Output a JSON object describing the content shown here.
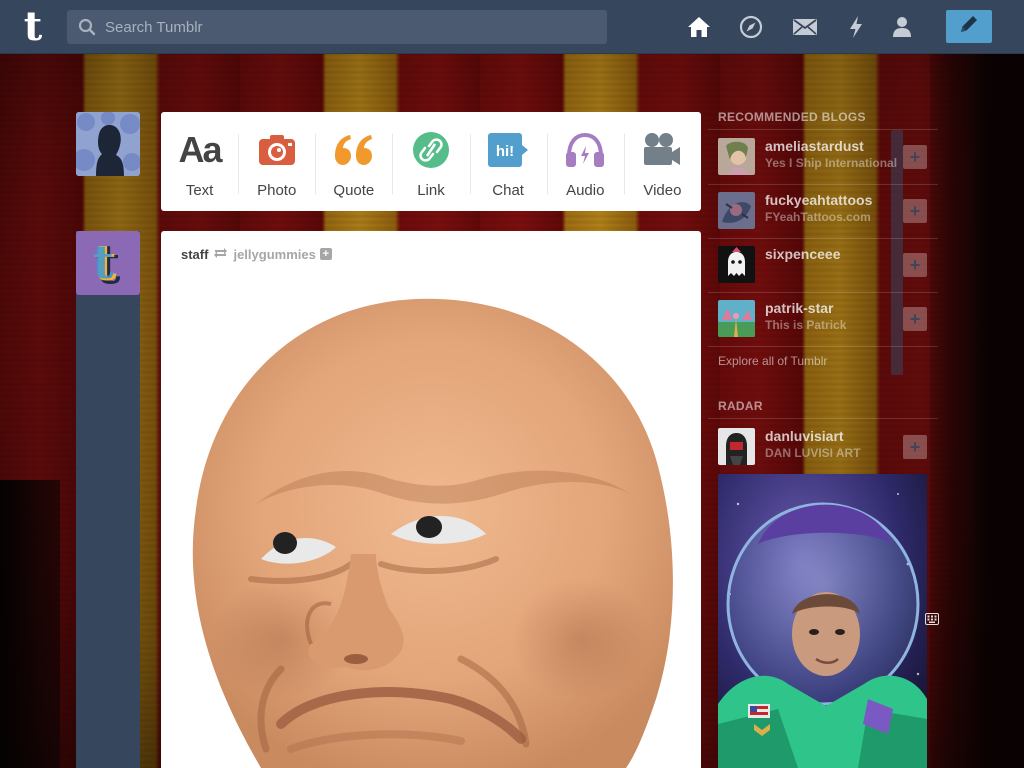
{
  "header": {
    "logo_text": "t",
    "search_placeholder": "Search Tumblr",
    "icons": [
      "home-icon",
      "explore-compass-icon",
      "inbox-mail-icon",
      "activity-lightning-icon",
      "account-person-icon",
      "compose-pencil-icon"
    ]
  },
  "post_types": [
    {
      "label": "Text",
      "icon": "text-aa-icon",
      "glyph": "Aa",
      "color": "#444444"
    },
    {
      "label": "Photo",
      "icon": "camera-icon",
      "color": "#d95e40"
    },
    {
      "label": "Quote",
      "icon": "quote-icon",
      "color": "#f2992e"
    },
    {
      "label": "Link",
      "icon": "link-icon",
      "color": "#56bc8a"
    },
    {
      "label": "Chat",
      "icon": "chat-bubble-icon",
      "glyph": "hi!",
      "color": "#529ecc"
    },
    {
      "label": "Audio",
      "icon": "headphones-icon",
      "color": "#a77dc2"
    },
    {
      "label": "Video",
      "icon": "video-camera-icon",
      "color": "#748089"
    }
  ],
  "post": {
    "author": "staff",
    "source": "jellygummies",
    "follow_glyph": "+"
  },
  "sidebar": {
    "recommended_title": "RECOMMENDED BLOGS",
    "blogs": [
      {
        "name": "ameliastardust",
        "desc": "Yes I Ship Internationally"
      },
      {
        "name": "fuckyeahtattoos",
        "desc": "FYeahTattoos.com"
      },
      {
        "name": "sixpenceee",
        "desc": ""
      },
      {
        "name": "patrik-star",
        "desc": "This is Patrick"
      }
    ],
    "follow_glyph": "+",
    "explore_text": "Explore all of Tumblr",
    "radar_title": "RADAR",
    "radar": {
      "name": "danluvisiart",
      "desc": "DAN LUVISI ART"
    }
  },
  "colors": {
    "header_bg": "#36465d",
    "search_bg": "#4b5a70",
    "compose_bg": "#529ecc"
  }
}
